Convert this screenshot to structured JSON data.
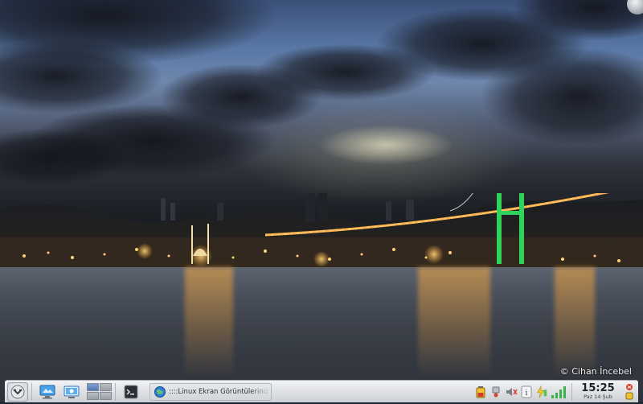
{
  "desktop": {
    "watermark": "© Cihan İncebel"
  },
  "panel": {
    "taskbar": {
      "task_label": "::::Linux Ekran Görüntüleriniz Buraya"
    },
    "clock": {
      "time": "15:25",
      "date": "Paz 14 Şub"
    },
    "icons": {
      "kickoff": "kde-menu-icon",
      "desktop": "show-desktop-icon",
      "system": "system-settings-icon",
      "terminal": "terminal-icon",
      "task": "browser-globe-icon",
      "tray": [
        "battery-icon",
        "network-icon",
        "volume-muted-icon",
        "info-icon",
        "power-icon",
        "signal-icon"
      ],
      "cashew": "panel-toolbox-icon"
    },
    "colors": {
      "accent": "#4f78b4",
      "panel": "#dfe1e4"
    }
  }
}
